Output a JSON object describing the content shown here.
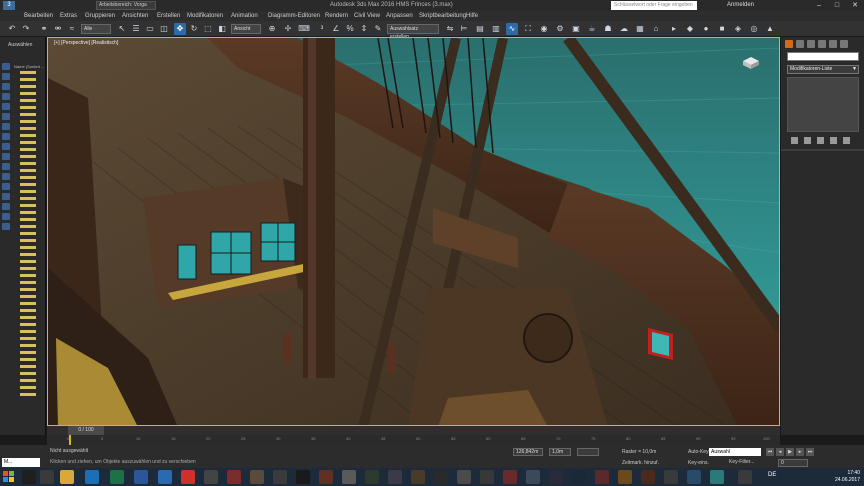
{
  "titlebar": {
    "workspace": "Arbeitsbereich: Vorga",
    "title": "Autodesk 3ds Max 2016     HMS Frinces (3.max)",
    "search_placeholder": "Schlüsselwort oder Frage eingeben",
    "login": "Anmelden"
  },
  "menu": [
    "Bearbeiten",
    "Extras",
    "Gruppieren",
    "Ansichten",
    "Erstellen",
    "Modifikatoren",
    "Animation",
    "Diagramm-Editoren",
    "Rendern",
    "Civil View",
    "Anpassen",
    "Skriptbearbeitung",
    "Hilfe"
  ],
  "toolbar": {
    "selection_filter": "Alle",
    "reference_coord": "Ansicht",
    "named_selection": "Auswahlsatz erstellen"
  },
  "left_panel": {
    "label": "Auswählen",
    "name_header": "Name (Sortiert ..."
  },
  "viewport": {
    "label": "[+] [Perspective] [Realistisch]"
  },
  "right_panel": {
    "modifier_list": "Modifikatoren-Liste"
  },
  "timeline": {
    "slider": "0 / 100",
    "ticks": [
      "0",
      "5",
      "10",
      "15",
      "20",
      "25",
      "30",
      "35",
      "40",
      "45",
      "50",
      "55",
      "60",
      "65",
      "70",
      "75",
      "80",
      "85",
      "90",
      "95",
      "100"
    ]
  },
  "status": {
    "selection": "Nicht ausgewählt",
    "prompt": "Klicken und ziehen, um Objekte auszuwählen und zu verschieben",
    "maxscript": "M...",
    "x": "126,842m",
    "y": "1,0m",
    "z": "",
    "grid": "Raster = 10,0m",
    "add_time_tag": "Zeitmark. hinzuf.",
    "autokey": "Auto-Key",
    "keymode": "Key-eins.",
    "autokey_select": "Auswahl",
    "key_filter": "Key-Filter...",
    "frame": "0"
  },
  "taskbar": {
    "lang": "DE",
    "time": "17:40",
    "date": "24.06.2017"
  },
  "colors": {
    "viewport_border": "#d7b62a",
    "accent_blue": "#2f6aa8",
    "water": "#2c7c7a"
  }
}
